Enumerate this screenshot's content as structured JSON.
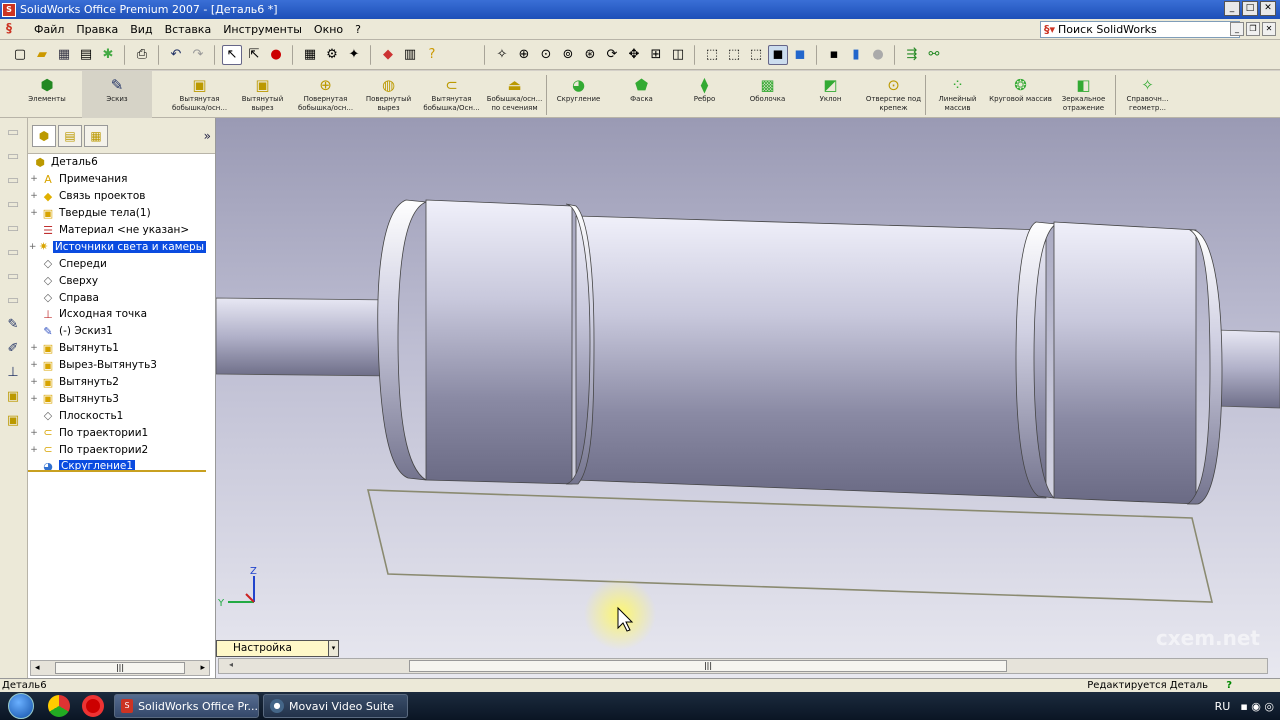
{
  "window": {
    "title": "SolidWorks Office Premium 2007 - [Деталь6 *]"
  },
  "menu": {
    "items": [
      "Файл",
      "Правка",
      "Вид",
      "Вставка",
      "Инструменты",
      "Окно",
      "?"
    ],
    "search_label": "Поиск SolidWorks"
  },
  "command_manager": {
    "items": [
      {
        "label": "Элементы",
        "icon": "features-icon"
      },
      {
        "label": "Эскиз",
        "icon": "sketch-icon"
      },
      {
        "label": "Вытянутая бобышка/осн...",
        "icon": "extrude-boss-icon"
      },
      {
        "label": "Вытянутый вырез",
        "icon": "extrude-cut-icon"
      },
      {
        "label": "Повернутая бобышка/осн...",
        "icon": "revolve-boss-icon"
      },
      {
        "label": "Повернутый вырез",
        "icon": "revolve-cut-icon"
      },
      {
        "label": "Вытянутая бобышка/Осн...",
        "icon": "sweep-boss-icon"
      },
      {
        "label": "Бобышка/осн... по сечениям",
        "icon": "loft-boss-icon"
      },
      {
        "label": "Скругление",
        "icon": "fillet-icon"
      },
      {
        "label": "Фаска",
        "icon": "chamfer-icon"
      },
      {
        "label": "Ребро",
        "icon": "rib-icon"
      },
      {
        "label": "Оболочка",
        "icon": "shell-icon"
      },
      {
        "label": "Уклон",
        "icon": "draft-icon"
      },
      {
        "label": "Отверстие под крепеж",
        "icon": "hole-wizard-icon"
      },
      {
        "label": "Линейный массив",
        "icon": "linear-pattern-icon"
      },
      {
        "label": "Круговой массив",
        "icon": "circular-pattern-icon"
      },
      {
        "label": "Зеркальное отражение",
        "icon": "mirror-icon"
      },
      {
        "label": "Справочн... геометр...",
        "icon": "ref-geometry-icon"
      }
    ]
  },
  "feature_tree": {
    "root": "Деталь6",
    "items": [
      {
        "label": "Примечания",
        "expand": true,
        "icon": "annotations-icon",
        "glyph": "A",
        "color": "#d8a400"
      },
      {
        "label": "Связь проектов",
        "expand": true,
        "icon": "design-binder-icon",
        "glyph": "◆",
        "color": "#e0b000"
      },
      {
        "label": "Твердые тела(1)",
        "expand": true,
        "icon": "solid-bodies-icon",
        "glyph": "▣",
        "color": "#d8a400"
      },
      {
        "label": "Материал <не указан>",
        "expand": false,
        "icon": "material-icon",
        "glyph": "☰",
        "color": "#c03030"
      },
      {
        "label": "Источники света и камеры",
        "expand": true,
        "icon": "lights-cameras-icon",
        "glyph": "✷",
        "color": "#d8a400",
        "selected": true
      },
      {
        "label": "Спереди",
        "expand": false,
        "icon": "plane-icon",
        "glyph": "◇",
        "color": "#666"
      },
      {
        "label": "Сверху",
        "expand": false,
        "icon": "plane-icon",
        "glyph": "◇",
        "color": "#666"
      },
      {
        "label": "Справа",
        "expand": false,
        "icon": "plane-icon",
        "glyph": "◇",
        "color": "#666"
      },
      {
        "label": "Исходная точка",
        "expand": false,
        "icon": "origin-icon",
        "glyph": "⊥",
        "color": "#c03030"
      },
      {
        "label": "(-) Эскиз1",
        "expand": false,
        "icon": "sketch-icon",
        "glyph": "✎",
        "color": "#3050c0"
      },
      {
        "label": "Вытянуть1",
        "expand": true,
        "icon": "extrude-icon",
        "glyph": "▣",
        "color": "#d8a400"
      },
      {
        "label": "Вырез-Вытянуть3",
        "expand": true,
        "icon": "cut-extrude-icon",
        "glyph": "▣",
        "color": "#d8a400"
      },
      {
        "label": "Вытянуть2",
        "expand": true,
        "icon": "extrude-icon",
        "glyph": "▣",
        "color": "#d8a400"
      },
      {
        "label": "Вытянуть3",
        "expand": true,
        "icon": "extrude-icon",
        "glyph": "▣",
        "color": "#d8a400"
      },
      {
        "label": "Плоскость1",
        "expand": false,
        "icon": "plane-icon",
        "glyph": "◇",
        "color": "#666"
      },
      {
        "label": "По траектории1",
        "expand": true,
        "icon": "sweep-icon",
        "glyph": "⊂",
        "color": "#d8a400"
      },
      {
        "label": "По траектории2",
        "expand": true,
        "icon": "sweep-icon",
        "glyph": "⊂",
        "color": "#d8a400"
      },
      {
        "label": "Скругление1",
        "expand": false,
        "icon": "fillet-icon",
        "glyph": "◕",
        "color": "#3070d0",
        "selected": true
      }
    ]
  },
  "viewport": {
    "configuration_tab": "Настройка",
    "triad": {
      "y": "Y",
      "z": "Z"
    },
    "watermark": "cxem.net"
  },
  "status": {
    "left": "Деталь6",
    "right": "Редактируется Деталь"
  },
  "taskbar": {
    "tasks": [
      "SolidWorks Office Pr...",
      "Movavi Video Suite"
    ],
    "language": "RU"
  }
}
